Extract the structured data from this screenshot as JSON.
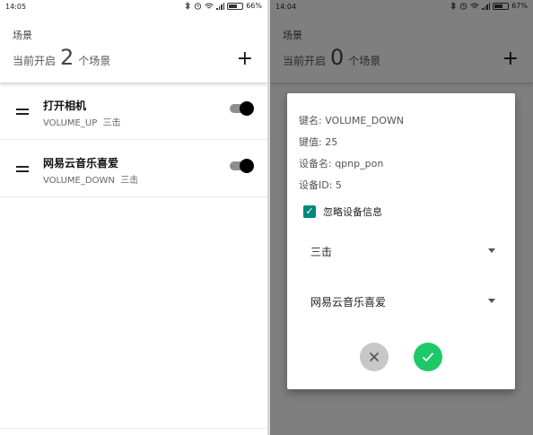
{
  "left": {
    "status": {
      "time": "14:05",
      "battery": "66%",
      "battery_level": 0.66
    },
    "header": {
      "title": "场景",
      "prefix": "当前开启",
      "count": "2",
      "suffix": "个场景",
      "add_symbol": "+"
    },
    "scenes": [
      {
        "name": "打开相机",
        "key": "VOLUME_UP",
        "mode": "三击",
        "enabled": true
      },
      {
        "name": "网易云音乐喜爱",
        "key": "VOLUME_DOWN",
        "mode": "三击",
        "enabled": true
      }
    ]
  },
  "right": {
    "status": {
      "time": "14:04",
      "battery": "67%",
      "battery_level": 0.67
    },
    "header": {
      "title": "场景",
      "prefix": "当前开启",
      "count": "0",
      "suffix": "个场景",
      "add_symbol": "+"
    },
    "dialog": {
      "key_name": "键名: VOLUME_DOWN",
      "key_value": "键值: 25",
      "device_name": "设备名: qpnp_pon",
      "device_id": "设备ID: 5",
      "ignore_device_label": "忽略设备信息",
      "ignore_device_checked": true,
      "trigger_select": "三击",
      "action_select": "网易云音乐喜爱",
      "cancel_symbol": "✕",
      "confirm_symbol": "✓"
    }
  },
  "colors": {
    "checkbox": "#00897b",
    "confirm": "#1fc866",
    "cancel": "#c7c7c7",
    "toggle_thumb": "#000000",
    "toggle_track": "#8e8e8e"
  },
  "icons": [
    "bluetooth-icon",
    "alarm-icon",
    "wifi-icon",
    "signal-icon",
    "battery-icon",
    "add-icon",
    "drag-handle-icon",
    "dropdown-arrow-icon",
    "close-icon",
    "check-icon"
  ]
}
